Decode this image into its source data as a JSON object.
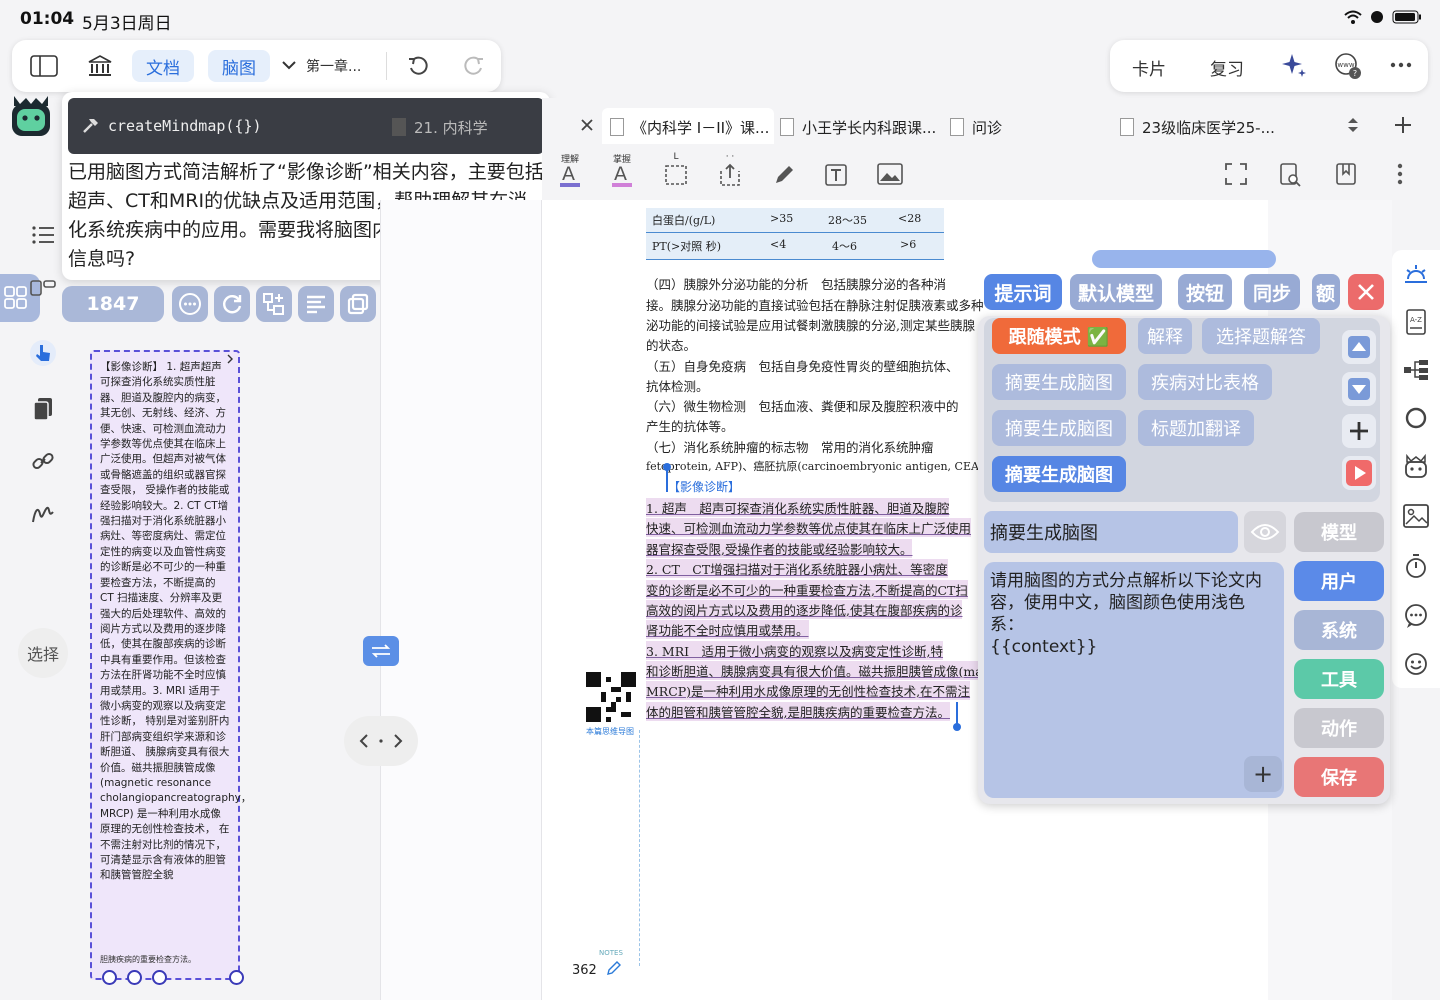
{
  "status": {
    "time": "01:04",
    "date": "5月3日周日"
  },
  "toolbar_left": {
    "doc_label": "文档",
    "mindmap_label": "脑图",
    "chapter": "第一章..."
  },
  "toolbar_right": {
    "card_label": "卡片",
    "review_label": "复习"
  },
  "chat": {
    "code": "createMindmap({})",
    "message": "已用脑图方式简洁解析了“影像诊断”相关内容，主要包括超声、CT和MRI的优缺点及适用范围，帮助理解其在消化系统疾病中的应用。需要我将脑图内容导出或补充其他信息吗?"
  },
  "action_bar": {
    "count": "1847"
  },
  "left_sidebar": {
    "select_label": "选择"
  },
  "card": {
    "text": "【影像诊断】 1. 超声超声可探查消化系统实质性脏器、胆道及腹腔内的病变， 其无创、无射线、经济、方便、快速、可检测血流动力学参数等优点使其在临床上广泛使用。但超声对被气体或骨骼遮盖的组织或器官探查受限， 受操作者的技能或经验影响较大。2. CT CT增强扫描对于消化系统脏器小病灶、等密度病灶、需定位定性的病变以及血管性病变的诊断是必不可少的一种重要检查方法，不断提高的 CT 扫描速度、分辨率及更强大的后处理软件、高效的阅片方式以及费用的逐步降低，使其在腹部疾病的诊断中具有重要作用。但该检查方法在肝肾功能不全时应慎用或禁用。3. MRI 适用于微小病变的观察以及病变定性诊断， 特别是对鉴别肝内肝门部病变组织学来源和诊断胆道、 胰腺病变具有很大价值。磁共振胆胰管成像 (magnetic resonance cholangiopancreatography， MRCP) 是一种利用水成像原理的无创性检查技术， 在不需注射对比剂的情况下， 可清楚显示含有液体的胆管和胰管管腔全貌",
    "footer": "胆胰疾病的重要检查方法。"
  },
  "tabs": [
    {
      "label": "21. 内科学"
    },
    {
      "label": "《内科学 I－II》课..."
    },
    {
      "label": "小王学长内科跟课..."
    },
    {
      "label": "问诊"
    },
    {
      "label": "23级临床医学25-..."
    }
  ],
  "annotation_tools": {
    "tool1": "理解",
    "tool2": "掌握",
    "tool3": "L",
    "tool4": "·  ·"
  },
  "page": {
    "table": [
      [
        "白蛋白/(g/L)",
        ">35",
        "28～35",
        "<28"
      ],
      [
        "PT(>对照  秒)",
        "<4",
        "4～6",
        ">6"
      ]
    ],
    "lines": [
      "（四）胰腺外分泌功能的分析　包括胰腺分泌的各种消",
      "接。胰腺分泌功能的直接试验包括在静脉注射促胰液素或多种",
      "泌功能的间接试验是应用试餐刺激胰腺的分泌,测定某些胰腺",
      "的状态。",
      "（五）自身免疫病　包括自身免疫性胃炎的壁细胞抗体、",
      "抗体检测。",
      "（六）微生物检测　包括血液、粪便和尿及腹腔积液中的",
      "产生的抗体等。",
      "（七）消化系统肿瘤的标志物　常用的消化系统肿瘤",
      "fetoprotein, AFP)、癌胚抗原(carcinoembryonic antigen, CEA)、C"
    ],
    "section": "【影像诊断】",
    "hl_lines": [
      "1. 超声　超声可探查消化系统实质性脏器、胆道及腹腔",
      "快速、可检测血流动力学参数等优点使其在临床上广泛使用",
      "器官探查受限,受操作者的技能或经验影响较大。",
      "2. CT　CT增强扫描对于消化系统脏器小病灶、等密度",
      "变的诊断是必不可少的一种重要检查方法,不断提高的CT扫",
      "高效的阅片方式以及费用的逐步降低,使其在腹部疾病的诊",
      "肾功能不全时应慎用或禁用。",
      "3. MRI　适用于微小病变的观察以及病变定性诊断,特",
      "和诊断胆道、胰腺病变具有很大价值。磁共振胆胰管成像(ma",
      "MRCP)是一种利用水成像原理的无创性检查技术,在不需注",
      "体的胆管和胰管管腔全貌,是胆胰疾病的重要检查方法。"
    ],
    "qr_caption": "本篇思维导图",
    "notes_label": "NOTES",
    "page_number": "362"
  },
  "prompt_panel": {
    "tabs": [
      "提示词",
      "默认模型",
      "按钮",
      "同步",
      "额"
    ],
    "buttons": [
      "跟随模式 ✅",
      "解释",
      "选择题解答",
      "摘要生成脑图",
      "疾病对比表格",
      "摘要生成脑图",
      "标题加翻译",
      "摘要生成脑图"
    ],
    "prompt_name": "摘要生成脑图",
    "prompt_text": "请用脑图的方式分点解析以下论文内容，使用中文，脑图颜色使用浅色系：\n{{context}}",
    "right_buttons": [
      "模型",
      "用户",
      "系统",
      "工具",
      "动作",
      "保存"
    ]
  },
  "colors": {
    "accent": "#2a6edc",
    "danger": "#ec6b6b",
    "follow": "#f06a3a",
    "user_btn": "#5b8ae8",
    "tool_btn": "#5cc9a8",
    "save_btn": "#e87676",
    "inactive": "#c0c0c8"
  }
}
